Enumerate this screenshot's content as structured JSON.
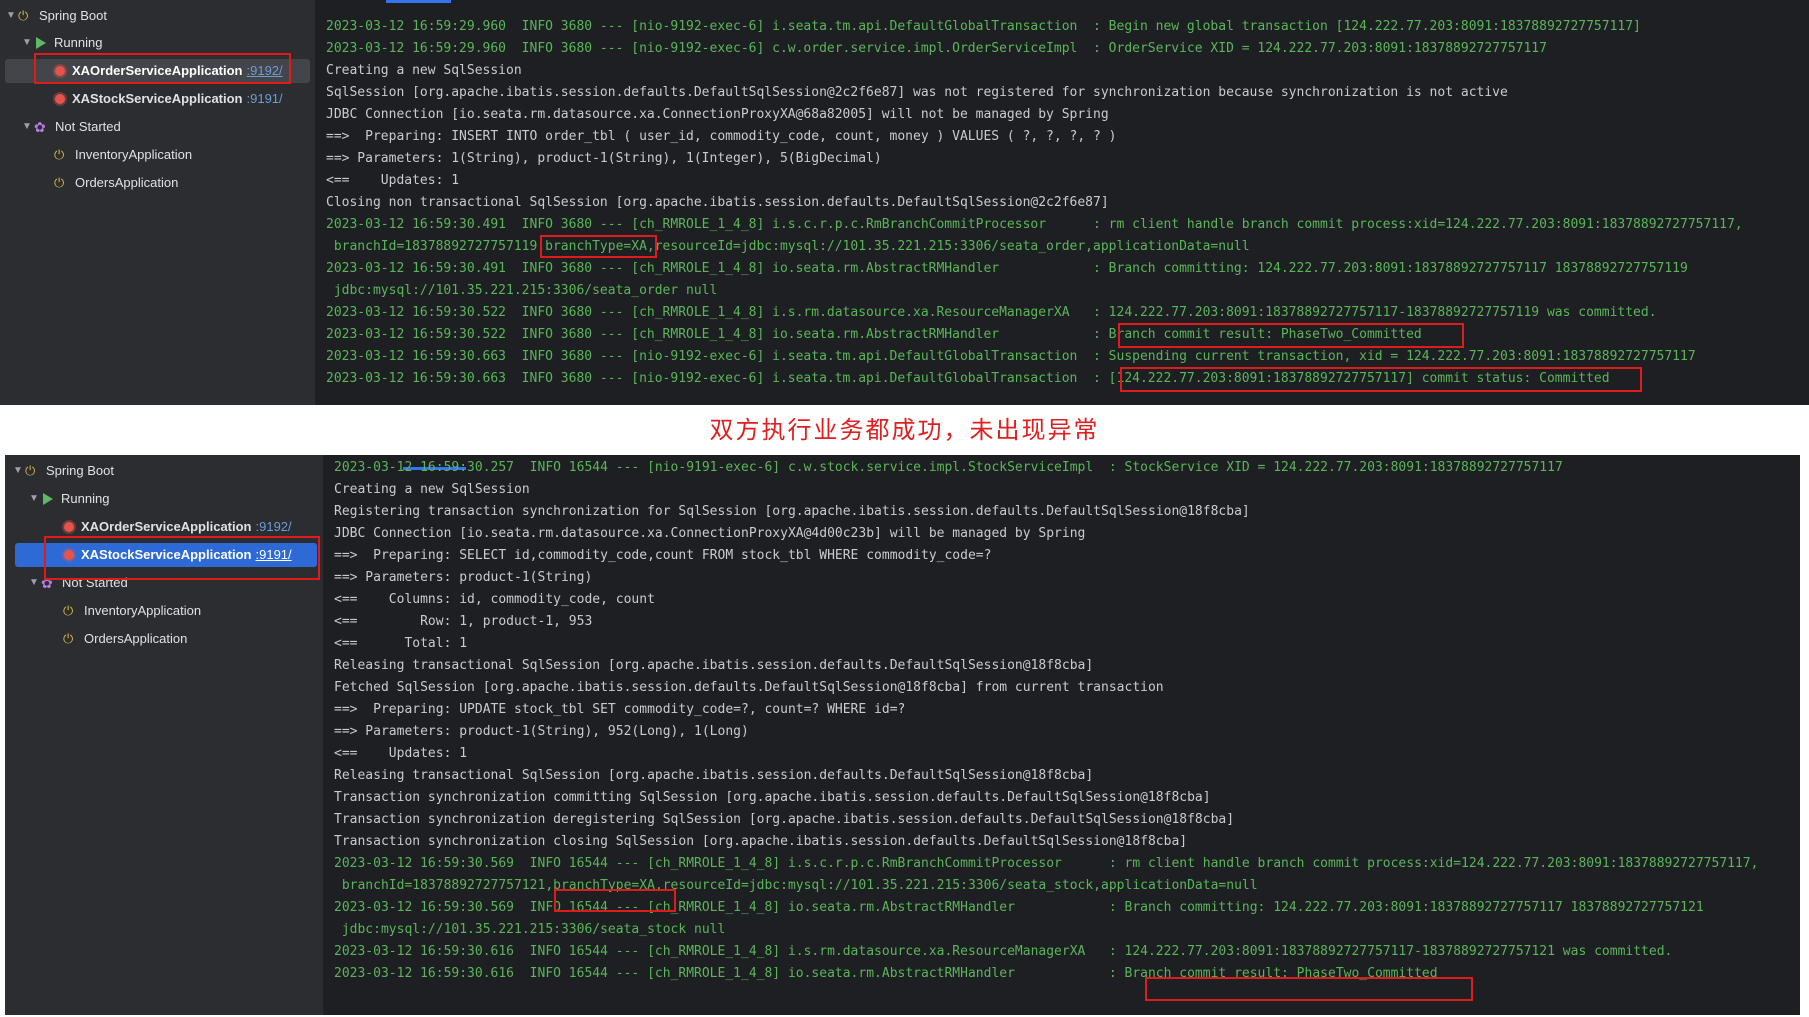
{
  "caption": "双方执行业务都成功，未出现异常",
  "colors": {
    "log_green": "#5ab55a",
    "log_default": "#c8cbd0",
    "highlight_box": "#e01b1b",
    "selected_row": "#2e6ad6"
  },
  "top": {
    "tree": {
      "root": "Spring Boot",
      "running": "Running",
      "app1": {
        "name": "XAOrderServiceApplication",
        "port": ":9192/"
      },
      "app2": {
        "name": "XAStockServiceApplication",
        "port": ":9191/"
      },
      "not_started": "Not Started",
      "app3": "InventoryApplication",
      "app4": "OrdersApplication"
    },
    "log": [
      "2023-03-12 16:59:29.960  INFO 3680 --- [nio-9192-exec-6] i.seata.tm.api.DefaultGlobalTransaction  : Begin new global transaction [124.222.77.203:8091:18378892727757117]",
      "2023-03-12 16:59:29.960  INFO 3680 --- [nio-9192-exec-6] c.w.order.service.impl.OrderServiceImpl  : OrderService XID = 124.222.77.203:8091:18378892727757117",
      "Creating a new SqlSession",
      "SqlSession [org.apache.ibatis.session.defaults.DefaultSqlSession@2c2f6e87] was not registered for synchronization because synchronization is not active",
      "JDBC Connection [io.seata.rm.datasource.xa.ConnectionProxyXA@68a82005] will not be managed by Spring",
      "==>  Preparing: INSERT INTO order_tbl ( user_id, commodity_code, count, money ) VALUES ( ?, ?, ?, ? )",
      "==> Parameters: 1(String), product-1(String), 1(Integer), 5(BigDecimal)",
      "<==    Updates: 1",
      "Closing non transactional SqlSession [org.apache.ibatis.session.defaults.DefaultSqlSession@2c2f6e87]",
      "2023-03-12 16:59:30.491  INFO 3680 --- [ch_RMROLE_1_4_8] i.s.c.r.p.c.RmBranchCommitProcessor      : rm client handle branch commit process:xid=124.222.77.203:8091:18378892727757117,",
      " branchId=18378892727757119,branchType=XA,resourceId=jdbc:mysql://101.35.221.215:3306/seata_order,applicationData=null",
      "2023-03-12 16:59:30.491  INFO 3680 --- [ch_RMROLE_1_4_8] io.seata.rm.AbstractRMHandler            : Branch committing: 124.222.77.203:8091:18378892727757117 18378892727757119",
      " jdbc:mysql://101.35.221.215:3306/seata_order null",
      "2023-03-12 16:59:30.522  INFO 3680 --- [ch_RMROLE_1_4_8] i.s.rm.datasource.xa.ResourceManagerXA   : 124.222.77.203:8091:18378892727757117-18378892727757119 was committed.",
      "2023-03-12 16:59:30.522  INFO 3680 --- [ch_RMROLE_1_4_8] io.seata.rm.AbstractRMHandler            : Branch commit result: PhaseTwo_Committed",
      "2023-03-12 16:59:30.663  INFO 3680 --- [nio-9192-exec-6] i.seata.tm.api.DefaultGlobalTransaction  : Suspending current transaction, xid = 124.222.77.203:8091:18378892727757117",
      "2023-03-12 16:59:30.663  INFO 3680 --- [nio-9192-exec-6] i.seata.tm.api.DefaultGlobalTransaction  : [124.222.77.203:8091:18378892727757117] commit status: Committed"
    ],
    "green_lines": [
      0,
      1,
      9,
      10,
      11,
      12,
      13,
      14,
      15,
      16
    ]
  },
  "bottom": {
    "tree": {
      "root": "Spring Boot",
      "running": "Running",
      "app1": {
        "name": "XAOrderServiceApplication",
        "port": ":9192/"
      },
      "app2": {
        "name": "XAStockServiceApplication",
        "port": ":9191/"
      },
      "not_started": "Not Started",
      "app3": "InventoryApplication",
      "app4": "OrdersApplication"
    },
    "log": [
      "2023-03-12 16:59:30.257  INFO 16544 --- [nio-9191-exec-6] c.w.stock.service.impl.StockServiceImpl  : StockService XID = 124.222.77.203:8091:18378892727757117",
      "Creating a new SqlSession",
      "Registering transaction synchronization for SqlSession [org.apache.ibatis.session.defaults.DefaultSqlSession@18f8cba]",
      "JDBC Connection [io.seata.rm.datasource.xa.ConnectionProxyXA@4d00c23b] will be managed by Spring",
      "==>  Preparing: SELECT id,commodity_code,count FROM stock_tbl WHERE commodity_code=?",
      "==> Parameters: product-1(String)",
      "<==    Columns: id, commodity_code, count",
      "<==        Row: 1, product-1, 953",
      "<==      Total: 1",
      "Releasing transactional SqlSession [org.apache.ibatis.session.defaults.DefaultSqlSession@18f8cba]",
      "Fetched SqlSession [org.apache.ibatis.session.defaults.DefaultSqlSession@18f8cba] from current transaction",
      "==>  Preparing: UPDATE stock_tbl SET commodity_code=?, count=? WHERE id=?",
      "==> Parameters: product-1(String), 952(Long), 1(Long)",
      "<==    Updates: 1",
      "Releasing transactional SqlSession [org.apache.ibatis.session.defaults.DefaultSqlSession@18f8cba]",
      "Transaction synchronization committing SqlSession [org.apache.ibatis.session.defaults.DefaultSqlSession@18f8cba]",
      "Transaction synchronization deregistering SqlSession [org.apache.ibatis.session.defaults.DefaultSqlSession@18f8cba]",
      "Transaction synchronization closing SqlSession [org.apache.ibatis.session.defaults.DefaultSqlSession@18f8cba]",
      "2023-03-12 16:59:30.569  INFO 16544 --- [ch_RMROLE_1_4_8] i.s.c.r.p.c.RmBranchCommitProcessor      : rm client handle branch commit process:xid=124.222.77.203:8091:18378892727757117,",
      " branchId=18378892727757121,branchType=XA,resourceId=jdbc:mysql://101.35.221.215:3306/seata_stock,applicationData=null",
      "2023-03-12 16:59:30.569  INFO 16544 --- [ch_RMROLE_1_4_8] io.seata.rm.AbstractRMHandler            : Branch committing: 124.222.77.203:8091:18378892727757117 18378892727757121",
      " jdbc:mysql://101.35.221.215:3306/seata_stock null",
      "2023-03-12 16:59:30.616  INFO 16544 --- [ch_RMROLE_1_4_8] i.s.rm.datasource.xa.ResourceManagerXA   : 124.222.77.203:8091:18378892727757117-18378892727757121 was committed.",
      "2023-03-12 16:59:30.616  INFO 16544 --- [ch_RMROLE_1_4_8] io.seata.rm.AbstractRMHandler            : Branch commit result: PhaseTwo_Committed"
    ],
    "green_lines": [
      0,
      18,
      19,
      20,
      21,
      22,
      23
    ]
  }
}
